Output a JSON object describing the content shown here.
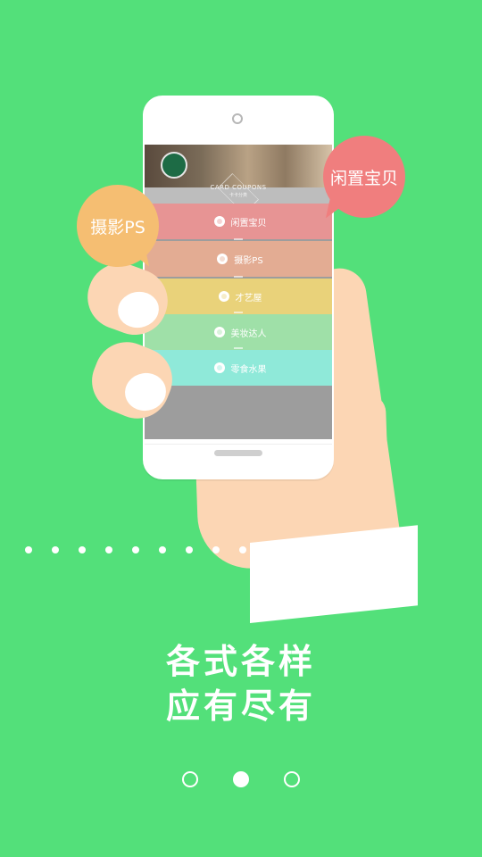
{
  "phone_screen": {
    "banner": {
      "title": "CARD COUPONS",
      "subtitle": "卡卡分类"
    },
    "categories": [
      {
        "label": "闲置宝贝",
        "color": "#e79494",
        "icon": "tag-icon"
      },
      {
        "label": "摄影PS",
        "color": "#e3ac93",
        "icon": "camera-icon"
      },
      {
        "label": "才艺屋",
        "color": "#e9d27a",
        "icon": "star-icon"
      },
      {
        "label": "美妆达人",
        "color": "#9fe0a8",
        "icon": "lipstick-icon"
      },
      {
        "label": "零食水果",
        "color": "#8fe9d9",
        "icon": "fruit-icon"
      }
    ]
  },
  "bubbles": {
    "pink": {
      "label": "闲置宝贝",
      "color": "#f07e7e"
    },
    "orange": {
      "label": "摄影PS",
      "color": "#f5be72"
    }
  },
  "headline": {
    "line1": "各式各样",
    "line2": "应有尽有"
  },
  "pager": {
    "total_pages": 3,
    "current_page": 2
  },
  "colors": {
    "background": "#53e07a",
    "skin": "#fcd6b4"
  }
}
